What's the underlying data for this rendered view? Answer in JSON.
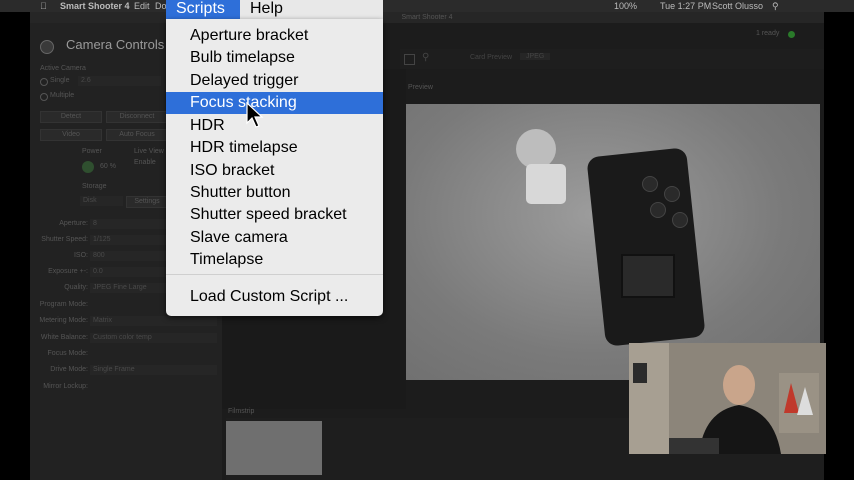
{
  "menubar": {
    "app_name": "Smart Shooter 4",
    "items": [
      "Edit",
      "Do"
    ],
    "clock": "Tue 1:27 PM",
    "user": "Scott Olusso",
    "battery": "100%"
  },
  "window": {
    "title": "Smart Shooter 4",
    "status": "1 ready"
  },
  "camera_controls": {
    "title": "Camera Controls",
    "active_camera_label": "Active Camera",
    "single_label": "Single",
    "single_value": "2.6",
    "multiple_label": "Multiple",
    "buttons": [
      "Detect",
      "Disconnect",
      "Video",
      "Auto Focus"
    ],
    "power_label": "Power",
    "live_view_label": "Live View",
    "zoom_value": "60 %",
    "enable_label": "Enable",
    "storage_label": "Storage",
    "disk_value": "Disk",
    "settings_label": "Settings",
    "params": [
      {
        "label": "Aperture:",
        "value": "8"
      },
      {
        "label": "Shutter Speed:",
        "value": "1/125"
      },
      {
        "label": "ISO:",
        "value": "800"
      },
      {
        "label": "Exposure +-:",
        "value": "0.0"
      },
      {
        "label": "Quality:",
        "value": "JPEG Fine Large"
      },
      {
        "label": "Program Mode:",
        "value": ""
      },
      {
        "label": "Metering Mode:",
        "value": "Matrix"
      },
      {
        "label": "White Balance:",
        "value": "Custom color temp"
      },
      {
        "label": "Focus Mode:",
        "value": ""
      },
      {
        "label": "Drive Mode:",
        "value": "Single Frame"
      },
      {
        "label": "Mirror Lockup:",
        "value": ""
      }
    ]
  },
  "toolbar": {
    "card_preview_label": "Card Preview",
    "format_value": "JPEG"
  },
  "preview": {
    "label": "Preview"
  },
  "filmstrip": {
    "label": "Filmstrip"
  },
  "menu": {
    "scripts_label": "Scripts",
    "help_label": "Help",
    "items": [
      "Aperture bracket",
      "Bulb timelapse",
      "Delayed trigger",
      "Focus stacking",
      "HDR",
      "HDR timelapse",
      "ISO bracket",
      "Shutter button",
      "Shutter speed bracket",
      "Slave camera",
      "Timelapse"
    ],
    "selected_index": 3,
    "load_label": "Load Custom Script ..."
  },
  "colors": {
    "accent": "#2e6fd9",
    "menu_bg": "#ebebeb"
  }
}
